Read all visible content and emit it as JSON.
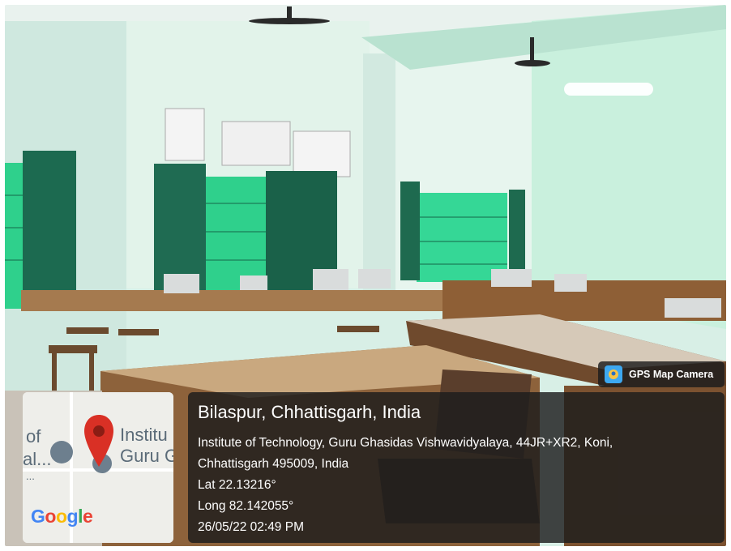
{
  "badge": {
    "label": "GPS Map Camera",
    "icon": "gps-camera-icon"
  },
  "location": {
    "title": "Bilaspur, Chhattisgarh, India",
    "address_line1": "Institute of Technology, Guru Ghasidas Vishwavidyalaya, 44JR+XR2, Koni,",
    "address_line2": "Chhattisgarh 495009, India",
    "lat": "Lat 22.13216°",
    "long": "Long 82.142055°",
    "datetime": "26/05/22 02:49 PM"
  },
  "map": {
    "fragments": [
      "of",
      "Institu",
      "Guru G",
      "al...",
      "..."
    ],
    "logo": {
      "letters": [
        "G",
        "o",
        "o",
        "g",
        "l",
        "e"
      ],
      "colors": [
        "#4285F4",
        "#EA4335",
        "#FBBC05",
        "#4285F4",
        "#34A853",
        "#EA4335"
      ]
    },
    "pin_color": "#D93025",
    "icon": "map-pin-icon"
  },
  "colors": {
    "wall": "#dff5ec",
    "curtain": "#1f6b52",
    "window": "#2fd08c",
    "bench": "#9a6a3e"
  }
}
